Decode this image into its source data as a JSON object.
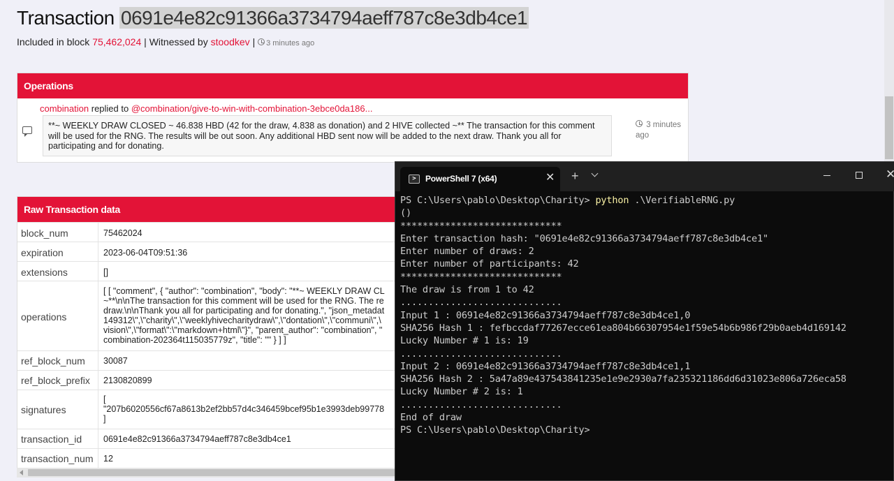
{
  "header": {
    "title_prefix": "Transaction",
    "tx_hash": "0691e4e82c91366a3734794aeff787c8e3db4ce1",
    "included_label": "Included in block",
    "block_number": "75,462,024",
    "sep1": "|",
    "witnessed_label": "Witnessed by",
    "witness": "stoodkev",
    "sep2": "|",
    "time_ago": "3 minutes ago"
  },
  "operations": {
    "heading": "Operations",
    "author": "combination",
    "action": "replied to",
    "target": "@combination/give-to-win-with-combination-3ebce0da186...",
    "body": "**~ WEEKLY DRAW CLOSED ~ 46.838 HBD (42 for the draw, 4.838 as donation) and 2 HIVE collected ~** The transaction for this comment will be used for the RNG. The results will be out soon. Any additional HBD sent now will be added to the next draw. Thank you all for participating and for donating.",
    "time_line1": "3 minutes",
    "time_line2": "ago"
  },
  "raw": {
    "heading": "Raw Transaction data",
    "rows": [
      {
        "key": "block_num",
        "lines": [
          "75462024"
        ]
      },
      {
        "key": "expiration",
        "lines": [
          "2023-06-04T09:51:36"
        ]
      },
      {
        "key": "extensions",
        "lines": [
          "[]"
        ]
      },
      {
        "key": "operations",
        "lines": [
          "[ [ \"comment\", { \"author\": \"combination\", \"body\": \"**~ WEEKLY DRAW CL",
          "~**\\n\\nThe transaction for this comment will be used for the RNG. The re",
          "draw.\\n\\nThank you all for participating and for donating.\", \"json_metadat",
          "149312\\\",\\\"charity\\\",\\\"weeklyhivecharitydraw\\\",\\\"dontation\\\",\\\"communi\\\",\\",
          "vision\\\",\\\"format\\\":\\\"markdown+html\\\"}\", \"parent_author\": \"combination\", \"",
          "combination-202364t115035779z\", \"title\": \"\" } ] ]"
        ]
      },
      {
        "key": "ref_block_num",
        "lines": [
          "30087"
        ]
      },
      {
        "key": "ref_block_prefix",
        "lines": [
          "2130820899"
        ]
      },
      {
        "key": "signatures",
        "lines": [
          "[",
          "\"207b6020556cf67a8613b2ef2bb57d4c346459bcef95b1e3993deb99778",
          "]"
        ]
      },
      {
        "key": "transaction_id",
        "lines": [
          "0691e4e82c91366a3734794aeff787c8e3db4ce1"
        ]
      },
      {
        "key": "transaction_num",
        "lines": [
          "12"
        ]
      }
    ]
  },
  "terminal": {
    "tab_title": "PowerShell 7 (x64)",
    "prompt": "PS C:\\Users\\pablo\\Desktop\\Charity> ",
    "command": "python",
    "command_args": " .\\VerifiableRNG.py",
    "lines": [
      "()",
      "*****************************",
      "Enter transaction hash: \"0691e4e82c91366a3734794aeff787c8e3db4ce1\"",
      "Enter number of draws: 2",
      "Enter number of participants: 42",
      "*****************************",
      "The draw is from 1 to 42",
      ".............................",
      "Input 1 : 0691e4e82c91366a3734794aeff787c8e3db4ce1,0",
      "SHA256 Hash 1 : fefbccdaf77267ecce61ea804b66307954e1f59e54b6b986f29b0aeb4d169142",
      "Lucky Number # 1 is: 19",
      ".............................",
      "Input 2 : 0691e4e82c91366a3734794aeff787c8e3db4ce1,1",
      "SHA256 Hash 2 : 5a47a89e437543841235e1e9e2930a7fa235321186dd6d31023e806a726eca58",
      "Lucky Number # 2 is: 1",
      ".............................",
      "End of draw",
      "PS C:\\Users\\pablo\\Desktop\\Charity>"
    ]
  },
  "colors": {
    "accent": "#e31337",
    "terminal_bg": "#0c0c0c",
    "terminal_text": "#cccccc",
    "terminal_command": "#f9f1a5"
  }
}
